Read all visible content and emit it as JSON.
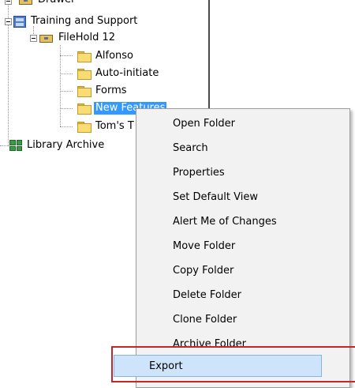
{
  "tree": {
    "drawer": "Drawer",
    "cabinet": "Training and Support",
    "drawer_sub": "FileHold 12",
    "folders": [
      "Alfonso",
      "Auto-initiate",
      "Forms",
      "New Features",
      "Tom's T"
    ],
    "library": "Library Archive"
  },
  "context_menu": {
    "items": [
      "Open Folder",
      "Search",
      "Properties",
      "Set Default View",
      "Alert Me of Changes",
      "Move Folder",
      "Copy Folder",
      "Delete Folder",
      "Clone Folder",
      "Archive Folder",
      "Export"
    ],
    "highlighted": "Export"
  }
}
